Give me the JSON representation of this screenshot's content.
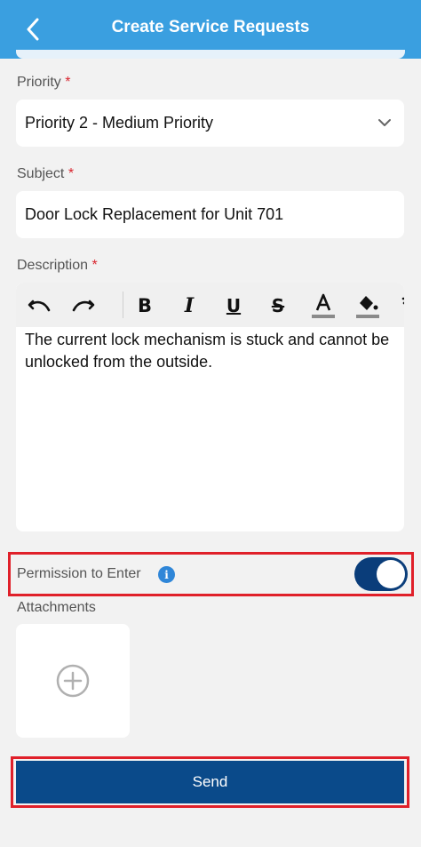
{
  "header": {
    "title": "Create Service Requests",
    "back_icon": "chevron-left-icon"
  },
  "priority": {
    "label": "Priority",
    "required_mark": "*",
    "value": "Priority 2 - Medium Priority"
  },
  "subject": {
    "label": "Subject",
    "required_mark": "*",
    "value": "Door Lock Replacement for Unit 701"
  },
  "description": {
    "label": "Description",
    "required_mark": "*",
    "toolbar": [
      "undo-icon",
      "redo-icon",
      "bold-icon",
      "italic-icon",
      "underline-icon",
      "strikethrough-icon",
      "text-color-icon",
      "fill-color-icon",
      "clear-format-icon"
    ],
    "value": "The current lock mechanism is stuck and cannot be unlocked from the outside."
  },
  "permission": {
    "label": "Permission to Enter",
    "info_icon": "i",
    "enabled": true
  },
  "attachments": {
    "label": "Attachments"
  },
  "send": {
    "label": "Send"
  },
  "colors": {
    "header": "#3a9fe0",
    "primary": "#0a4a8a",
    "highlight": "#e0202a"
  }
}
